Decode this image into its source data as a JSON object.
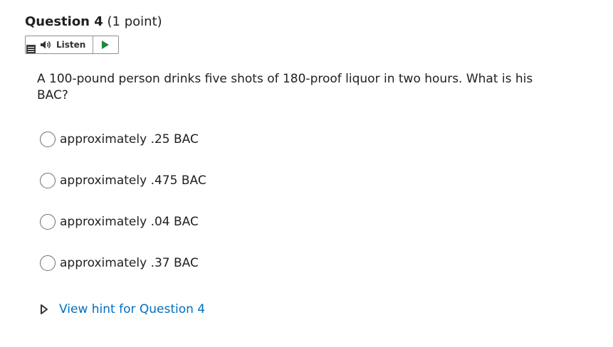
{
  "question": {
    "title": "Question 4",
    "points": "(1 point)",
    "text": "A 100-pound person drinks five shots of 180-proof liquor in two hours. What is his BAC?"
  },
  "listen_bar": {
    "menu_icon": "menu-icon",
    "speaker_icon": "speaker-icon",
    "listen_label": "Listen",
    "play_icon": "play-icon",
    "play_color": "#1a8a3b"
  },
  "options": [
    {
      "label": "approximately .25 BAC",
      "selected": false
    },
    {
      "label": "approximately .475 BAC",
      "selected": false
    },
    {
      "label": "approximately .04 BAC",
      "selected": false
    },
    {
      "label": "approximately .37 BAC",
      "selected": false
    }
  ],
  "hint": {
    "icon": "caret-right-outline-icon",
    "label": "View hint for Question 4",
    "link_color": "#006fbf"
  }
}
